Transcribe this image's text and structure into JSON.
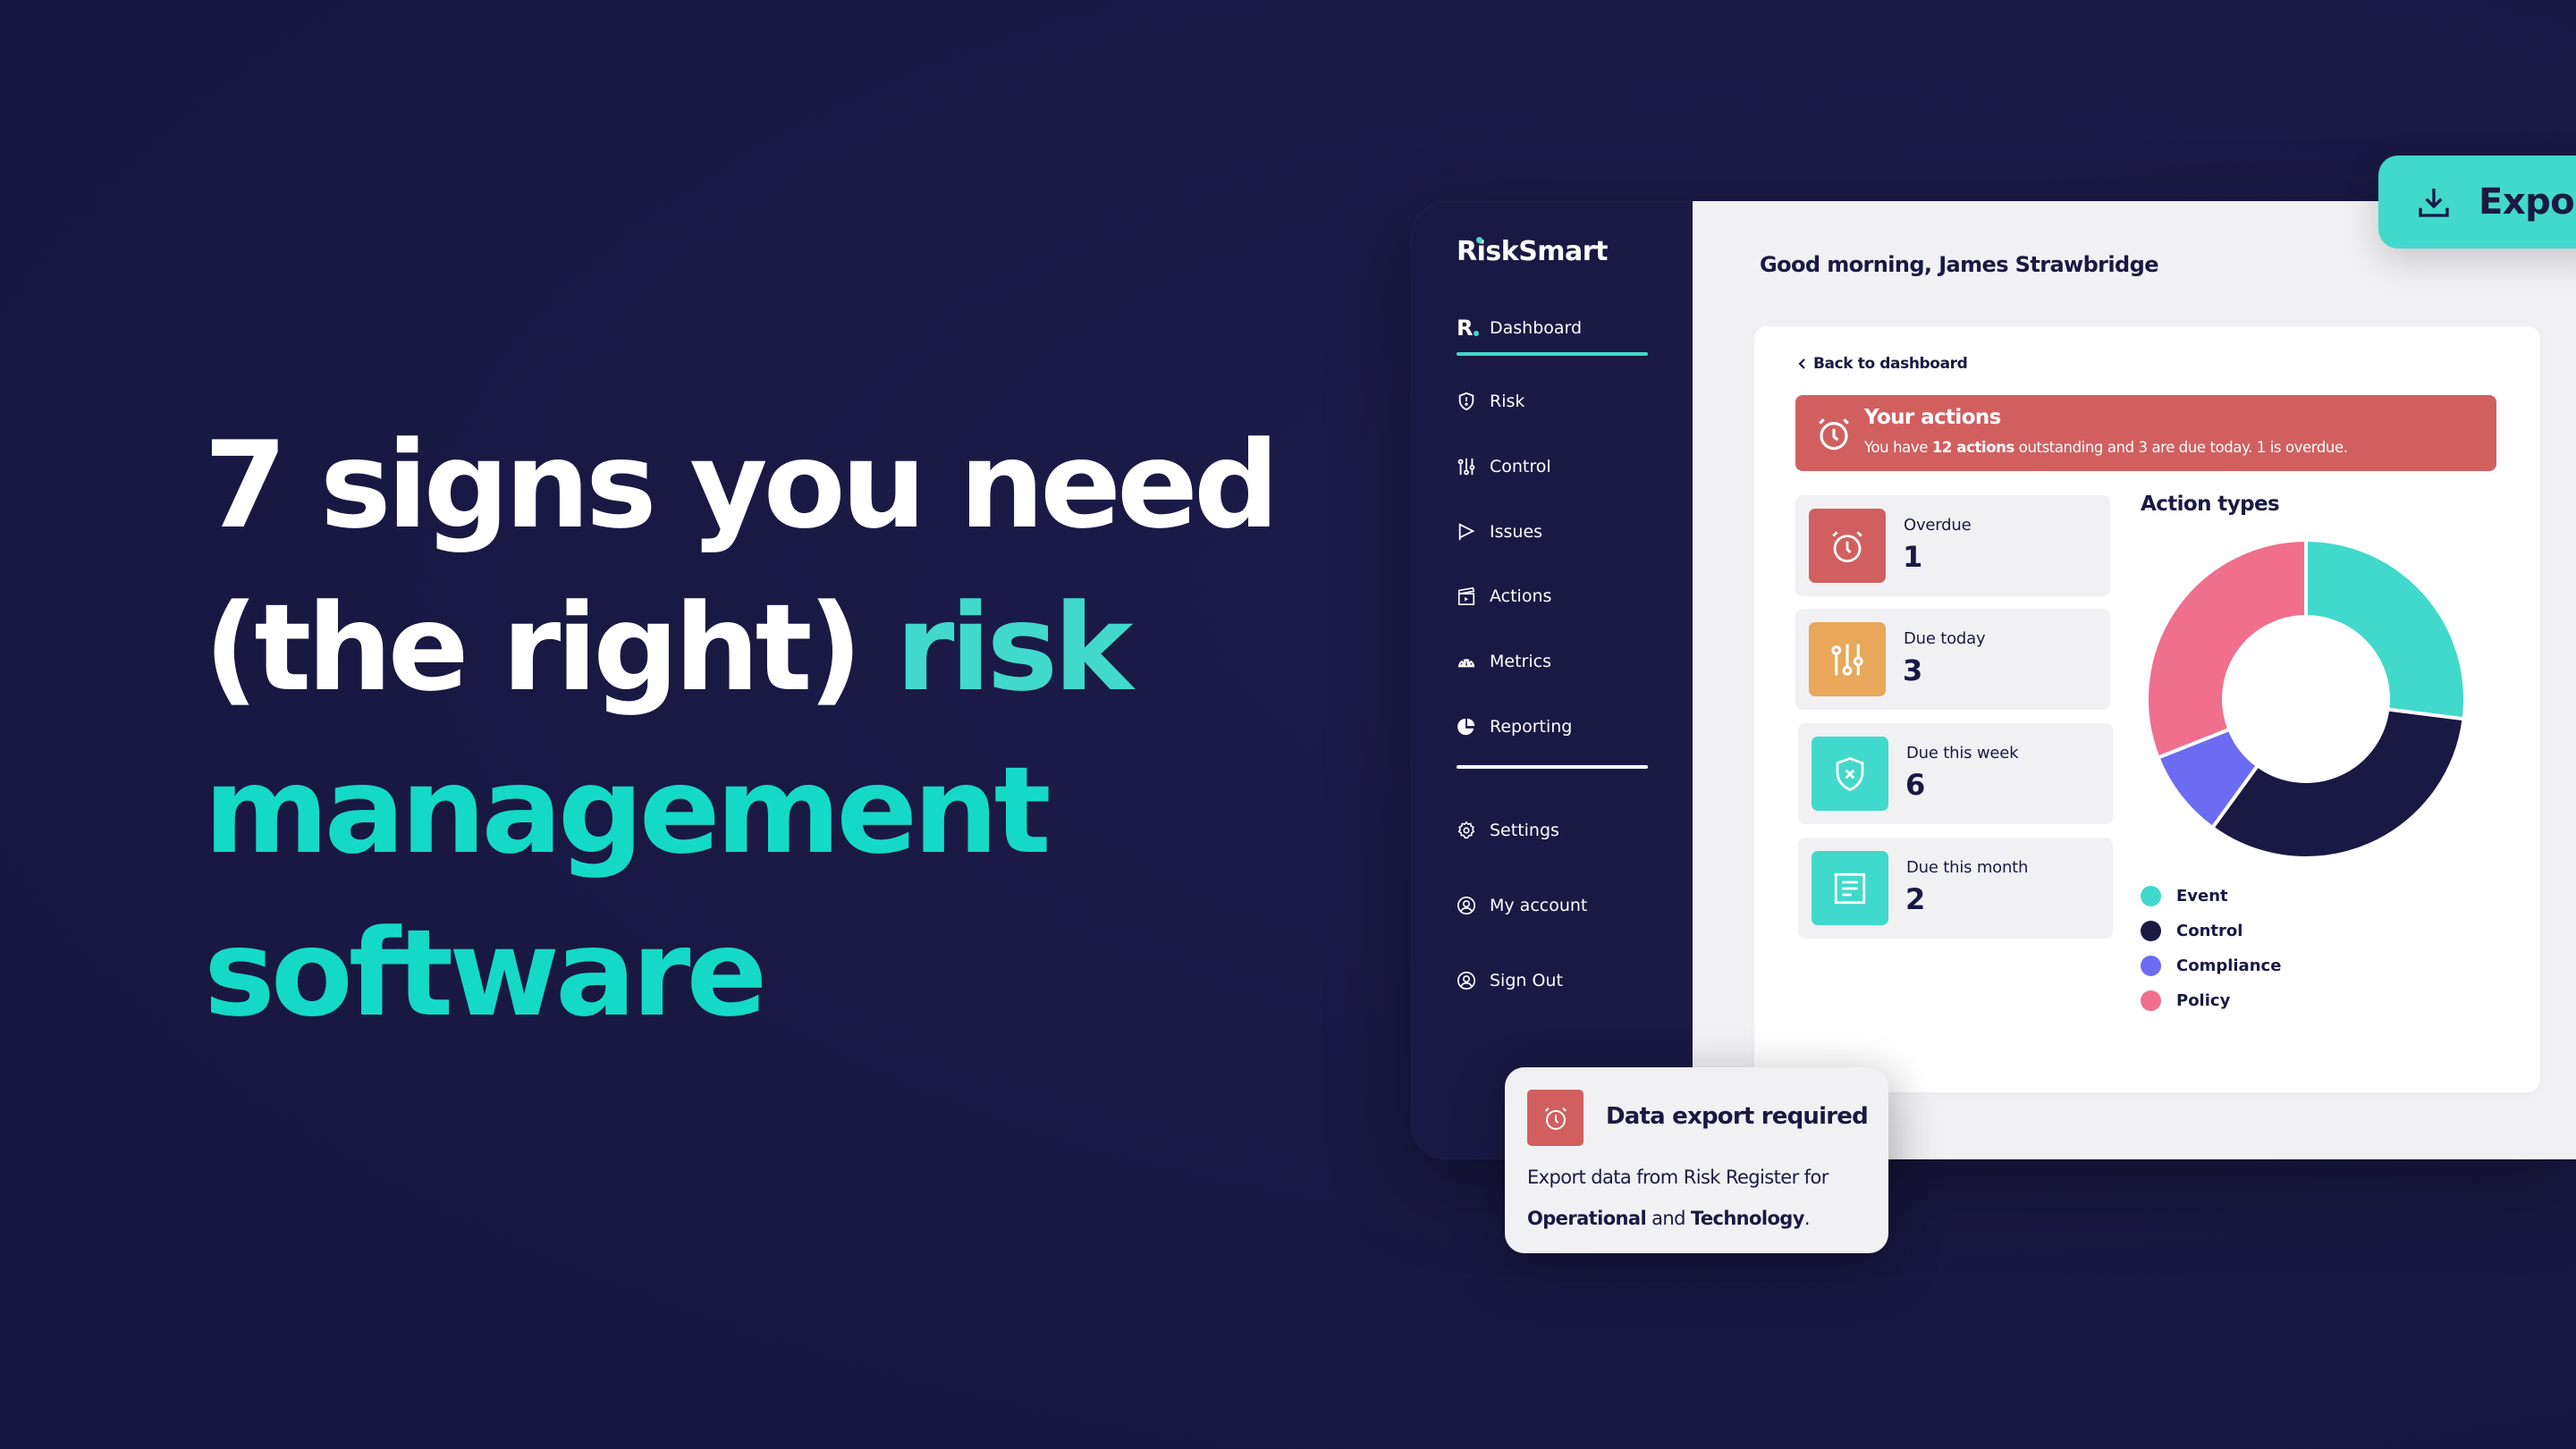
{
  "headline": {
    "line1": "7 signs you need",
    "line2_white": "(the right) ",
    "line2_accent": "risk",
    "line3": "management",
    "line4": "software"
  },
  "colors": {
    "background": "#1a1944",
    "accent": "#41d9cb",
    "accent_bright": "#15d9c7",
    "danger": "#d15f60",
    "warning": "#e8a75a",
    "navy": "#1a1944",
    "purple": "#6b6cf2",
    "pink": "#ef6f8d"
  },
  "app": {
    "logo": "RiskSmart",
    "sidebar": {
      "primary": [
        {
          "label": "Dashboard",
          "icon": "r-logo-icon",
          "active": true
        },
        {
          "label": "Risk",
          "icon": "shield-alert-icon"
        },
        {
          "label": "Control",
          "icon": "sliders-icon"
        },
        {
          "label": "Issues",
          "icon": "flag-icon"
        },
        {
          "label": "Actions",
          "icon": "clapperboard-icon"
        },
        {
          "label": "Metrics",
          "icon": "gauge-icon"
        },
        {
          "label": "Reporting",
          "icon": "pie-chart-icon"
        }
      ],
      "secondary": [
        {
          "label": "Settings",
          "icon": "gear-icon"
        },
        {
          "label": "My account",
          "icon": "user-circle-icon"
        },
        {
          "label": "Sign Out",
          "icon": "user-circle-icon"
        }
      ]
    },
    "greeting": "Good morning, James Strawbridge",
    "back_link": "Back to dashboard",
    "banner": {
      "title": "Your actions",
      "text_prefix": "You have ",
      "text_bold": "12 actions",
      "text_suffix": " outstanding and 3 are due today. 1 is overdue."
    },
    "stats": [
      {
        "label": "Overdue",
        "value": "1",
        "icon": "alarm-clock-icon",
        "color": "#d15f60"
      },
      {
        "label": "Due today",
        "value": "3",
        "icon": "sliders-icon",
        "color": "#e8a75a"
      },
      {
        "label": "Due this week",
        "value": "6",
        "icon": "shield-x-icon",
        "color": "#41d9cb"
      },
      {
        "label": "Due this month",
        "value": "2",
        "icon": "document-icon",
        "color": "#41d9cb"
      }
    ],
    "export_button": "Export"
  },
  "chart_data": {
    "type": "pie",
    "title": "Action types",
    "donut": true,
    "legend": "bottom",
    "categories": [
      "Event",
      "Control",
      "Compliance",
      "Policy"
    ],
    "values": [
      27,
      33,
      9,
      31
    ],
    "unit": "percent (estimated)",
    "colors": [
      "#41d9cb",
      "#1a1944",
      "#6b6cf2",
      "#ef6f8d"
    ]
  },
  "toast": {
    "title": "Data export required",
    "body_prefix": "Export data from Risk Register for ",
    "body_bold1": "Operational",
    "body_mid": " and ",
    "body_bold2": "Technology",
    "body_suffix": "."
  }
}
